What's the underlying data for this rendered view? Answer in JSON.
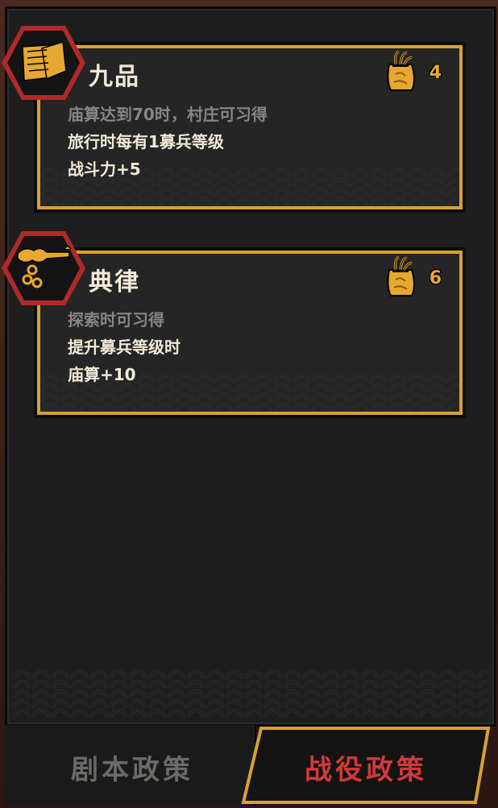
{
  "colors": {
    "accent_gold": "#d9a032",
    "active_tab_red": "#d23a3a",
    "inactive_tab_gray": "#6e6a66",
    "hex_red": "#b02a2a"
  },
  "policies": [
    {
      "icon": "scroll-bundle-icon",
      "title": "九品",
      "cost_icon": "grain-sack-icon",
      "cost": "4",
      "condition": "庙算达到70时，村庄可习得",
      "effect_1": "旅行时每有1募兵等级",
      "effect_2": "战斗力+5"
    },
    {
      "icon": "chained-keys-icon",
      "title": "典律",
      "cost_icon": "grain-sack-icon",
      "cost": "6",
      "condition": "探索时可习得",
      "effect_1": "提升募兵等级时",
      "effect_2": "庙算+10"
    }
  ],
  "tabs": {
    "script_policy": "剧本政策",
    "campaign_policy": "战役政策",
    "active": "campaign_policy"
  }
}
